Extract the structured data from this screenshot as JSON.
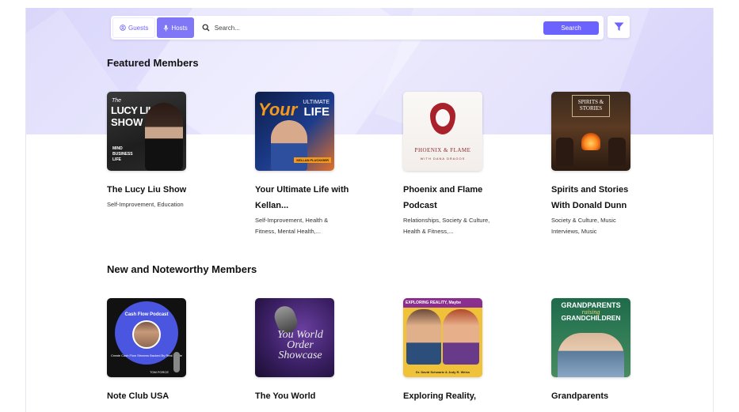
{
  "search": {
    "guests_label": "Guests",
    "hosts_label": "Hosts",
    "placeholder": "Search...",
    "button_label": "Search"
  },
  "featured": {
    "title": "Featured Members",
    "items": [
      {
        "title": "The Lucy Liu Show",
        "tags": "Self-Improvement, Education",
        "cover": {
          "line1": "The",
          "line2": "LUCY LIU",
          "line3": "SHOW",
          "tagline": "MIND\nBUSINESS\nLIFE"
        }
      },
      {
        "title": "Your Ultimate Life with Kellan...",
        "tags": "Self-Improvement, Health & Fitness, Mental Health,...",
        "cover": {
          "line1": "Your",
          "line2": "ULTIMATE",
          "line3": "LIFE",
          "badge": "KELLAN FLUCKIGER"
        }
      },
      {
        "title": "Phoenix and Flame Podcast",
        "tags": "Relationships, Society & Culture, Health & Fitness,...",
        "cover": {
          "name": "PHOENIX & FLAME",
          "sub": "WITH DANA DRAGOS"
        }
      },
      {
        "title": "Spirits and Stories With Donald Dunn",
        "tags": "Society & Culture, Music Interviews, Music",
        "cover": {
          "name": "SPIRITS & STORIES"
        }
      }
    ]
  },
  "noteworthy": {
    "title": "New and Noteworthy Members",
    "items": [
      {
        "title": "Note Club USA",
        "cover": {
          "heading": "Cash Flow Podcast",
          "sub": "Create Cash Flow Streams Backed By Real Estate",
          "name": "TOM FORCE"
        }
      },
      {
        "title": "The You World",
        "cover": {
          "name": "You World Order Showcase"
        }
      },
      {
        "title": "Exploring Reality,",
        "cover": {
          "heading": "EXPLORING REALITY, Maybe",
          "hosts": "Dr. David Schwartz & Jody R. Weiss"
        }
      },
      {
        "title": "Grandparents",
        "cover": {
          "line1": "GRANDPARENTS",
          "line2": "raising",
          "line3": "GRANDCHILDREN"
        }
      }
    ]
  },
  "colors": {
    "accent": "#6c63ff",
    "hero_bg": "#dedbfc"
  },
  "icons": {
    "guests": "user-circle-icon",
    "hosts": "microphone-icon",
    "search": "search-icon",
    "filter": "filter-icon"
  }
}
